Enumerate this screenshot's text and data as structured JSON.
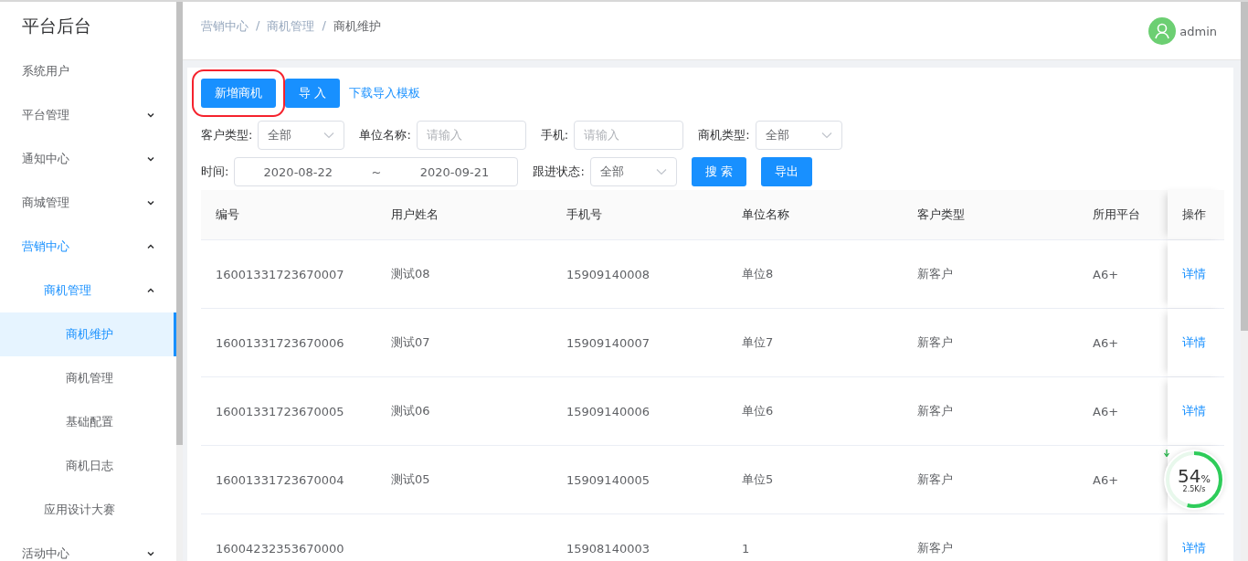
{
  "sidebar": {
    "title": "平台后台",
    "items": [
      {
        "label": "系统用户",
        "active": false,
        "selected": false
      },
      {
        "label": "平台管理",
        "active": false,
        "selected": false,
        "expanded": false
      },
      {
        "label": "通知中心",
        "active": false,
        "selected": false,
        "expanded": false
      },
      {
        "label": "商城管理",
        "active": false,
        "selected": false,
        "expanded": false
      },
      {
        "label": "营销中心",
        "active": true,
        "selected": false,
        "expanded": true,
        "children": [
          {
            "label": "商机管理",
            "active": true,
            "selected": false,
            "expanded": true,
            "children": [
              {
                "label": "商机维护",
                "active": true,
                "selected": true
              },
              {
                "label": "商机管理",
                "active": false,
                "selected": false
              },
              {
                "label": "基础配置",
                "active": false,
                "selected": false
              },
              {
                "label": "商机日志",
                "active": false,
                "selected": false
              }
            ]
          },
          {
            "label": "应用设计大赛",
            "active": false,
            "selected": false
          }
        ]
      },
      {
        "label": "活动中心",
        "active": false,
        "selected": false,
        "expanded": false
      }
    ]
  },
  "breadcrumb": {
    "separator": "/",
    "items": [
      "营销中心",
      "商机管理",
      "商机维护"
    ]
  },
  "user": {
    "name": "admin"
  },
  "toolbar": [
    {
      "label": "新增商机",
      "kind": "primary",
      "highlighted": true
    },
    {
      "label": "导 入",
      "kind": "primary",
      "highlighted": false
    },
    {
      "label": "下载导入模板",
      "kind": "link",
      "highlighted": false
    }
  ],
  "filters": [
    [
      {
        "kind": "select",
        "label": "客户类型:",
        "value": "全部"
      },
      {
        "kind": "input",
        "label": "单位名称:",
        "placeholder": "请输入"
      },
      {
        "kind": "input",
        "label": "手机:",
        "placeholder": "请输入"
      },
      {
        "kind": "select",
        "label": "商机类型:",
        "value": "全部"
      }
    ],
    [
      {
        "kind": "daterange",
        "label": "时间:",
        "start": "2020-08-22",
        "separator": "~",
        "end": "2020-09-21"
      },
      {
        "kind": "select",
        "label": "跟进状态:",
        "value": "全部"
      },
      {
        "kind": "button",
        "label": "搜 索"
      },
      {
        "kind": "button",
        "label": "导出"
      }
    ]
  ],
  "table": {
    "columns": [
      "编号",
      "用户姓名",
      "手机号",
      "单位名称",
      "客户类型",
      "所用平台",
      "操作"
    ],
    "rows": [
      {
        "cells": [
          "16001331723670007",
          "测试08",
          "15909140008",
          "单位8",
          "新客户",
          "A6+"
        ],
        "action": "详情"
      },
      {
        "cells": [
          "16001331723670006",
          "测试07",
          "15909140007",
          "单位7",
          "新客户",
          "A6+"
        ],
        "action": "详情"
      },
      {
        "cells": [
          "16001331723670005",
          "测试06",
          "15909140006",
          "单位6",
          "新客户",
          "A6+"
        ],
        "action": "详情"
      },
      {
        "cells": [
          "16001331723670004",
          "测试05",
          "15909140005",
          "单位5",
          "新客户",
          "A6+"
        ]
      },
      {
        "cells": [
          "16004232353670000",
          "",
          "15908140003",
          "1",
          "新客户",
          ""
        ],
        "action": "详情"
      }
    ]
  },
  "net_widget": {
    "value": "54",
    "unit": "%",
    "speed": "2.5K/s",
    "level": 0.54
  }
}
